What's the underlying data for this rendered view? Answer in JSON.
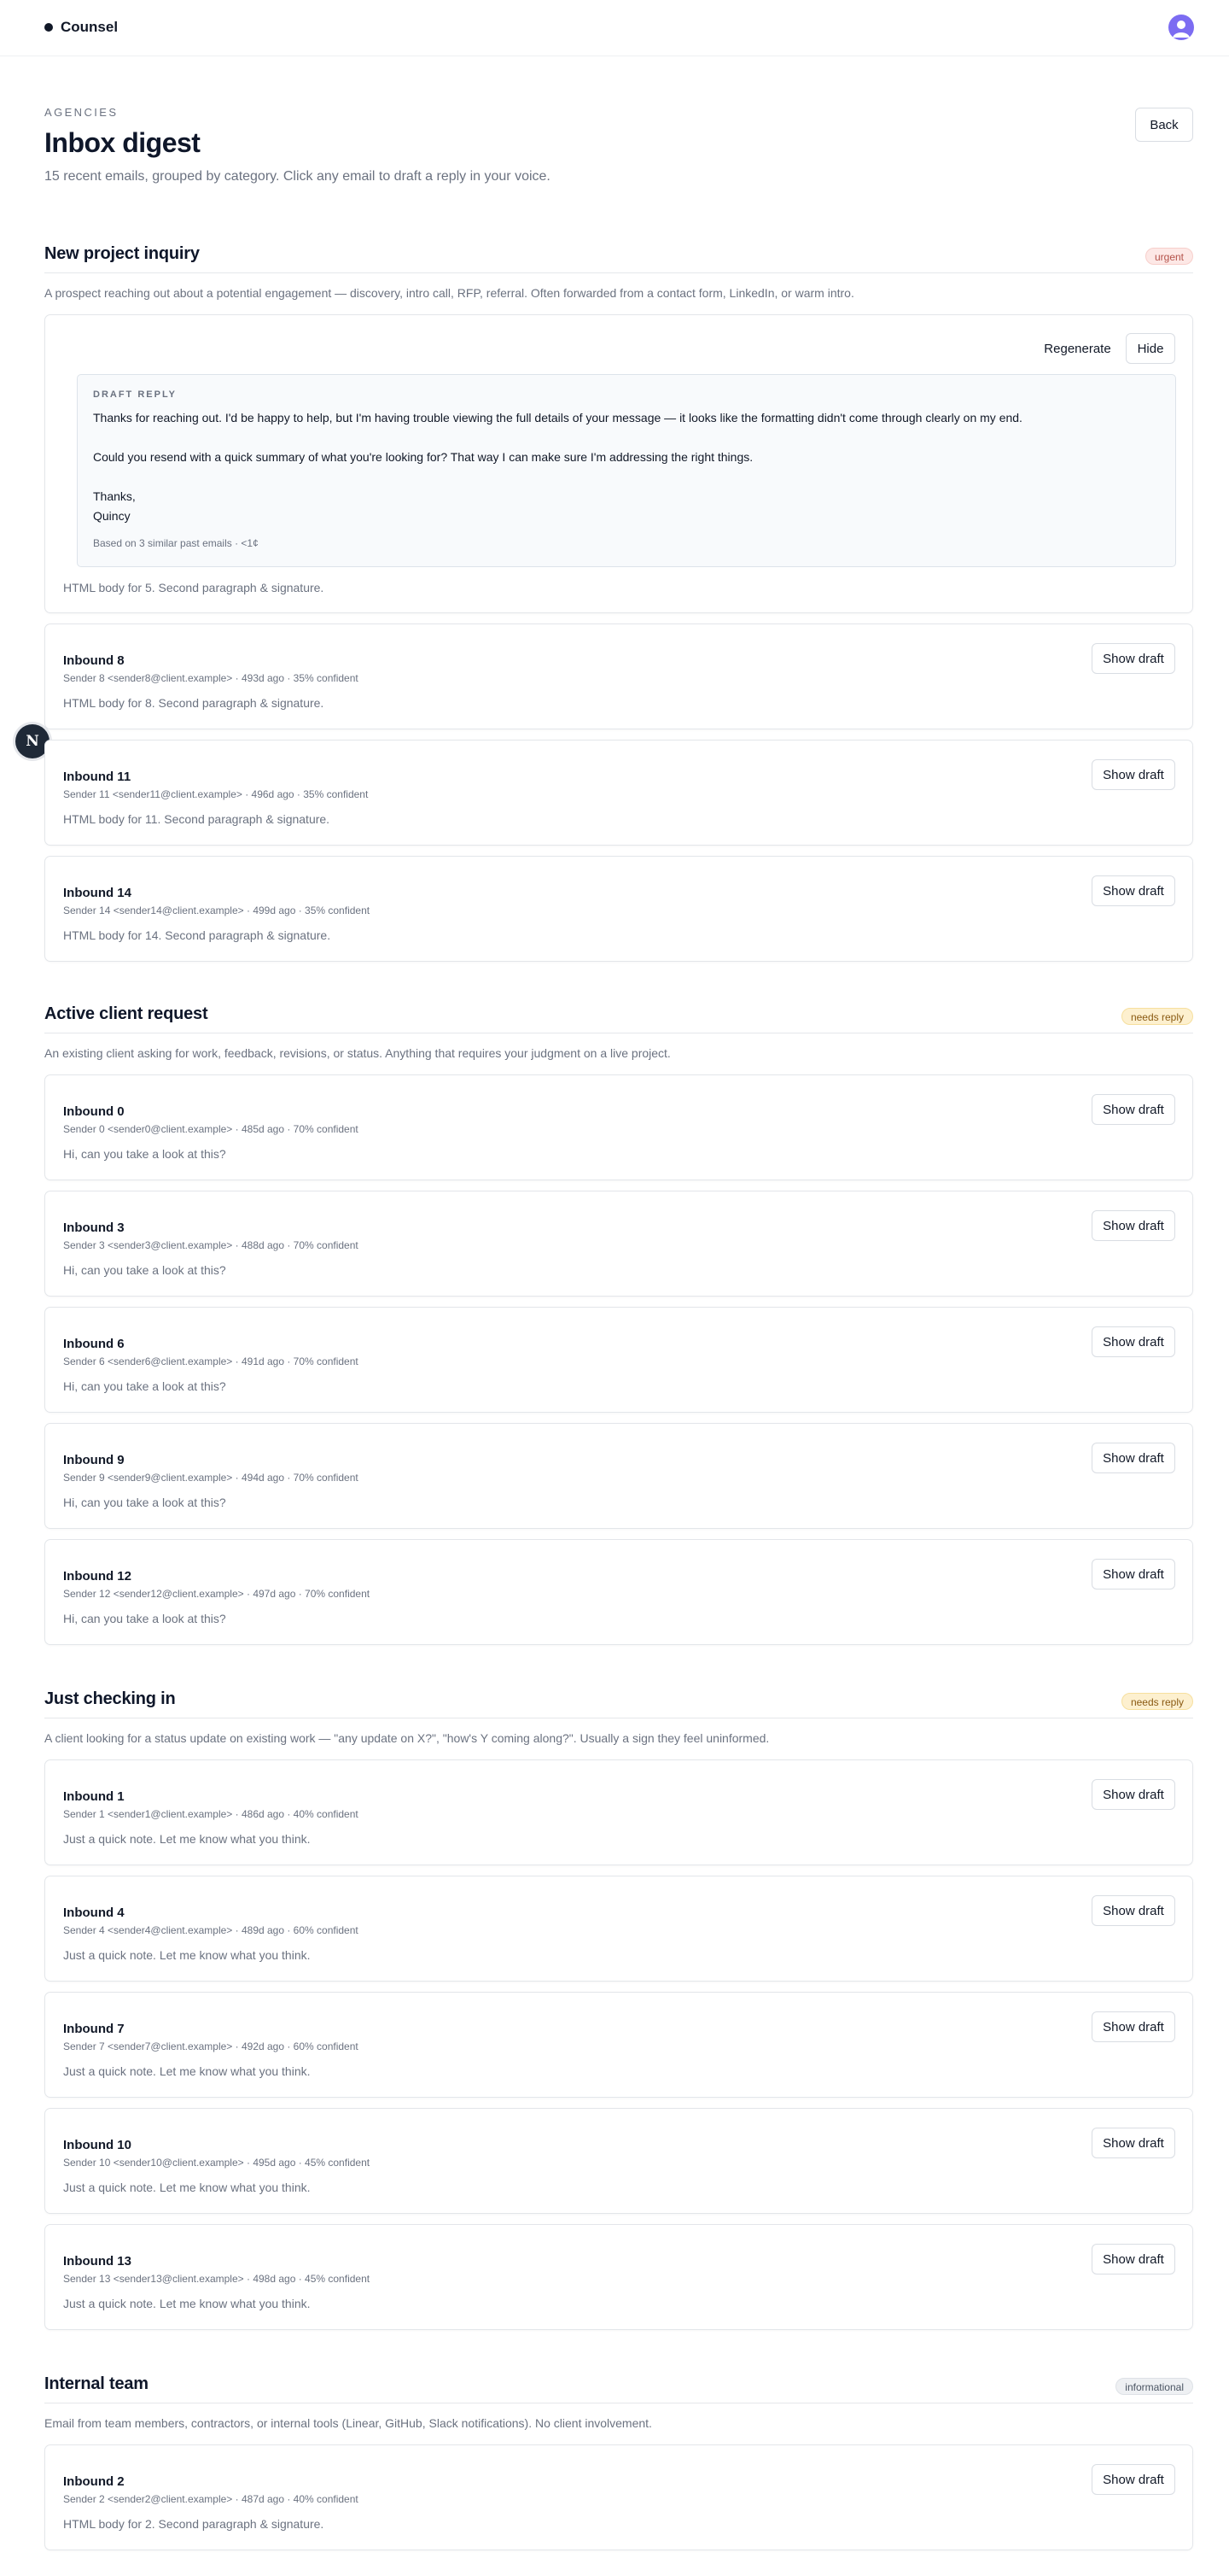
{
  "app": {
    "name": "Counsel"
  },
  "header": {
    "eyebrow": "AGENCIES",
    "title": "Inbox digest",
    "subtitle": "15 recent emails, grouped by category. Click any email to draft a reply in your voice.",
    "back_label": "Back"
  },
  "fab": {
    "label": "N"
  },
  "sections": [
    {
      "title": "New project inquiry",
      "badge": "urgent",
      "description": "A prospect reaching out about a potential engagement — discovery, intro call, RFP, referral. Often forwarded from a contact form, LinkedIn, or warm intro.",
      "open_card": {
        "regenerate_label": "Regenerate",
        "hide_label": "Hide",
        "draft_label": "DRAFT REPLY",
        "draft_lines": [
          "Thanks for reaching out. I'd be happy to help, but I'm having trouble viewing the full details of your message — it looks like the formatting didn't come through clearly on my end.",
          "Could you resend with a quick summary of what you're looking for? That way I can make sure I'm addressing the right things.",
          "Thanks,",
          "Quincy"
        ],
        "draft_footer": "Based on 3 similar past emails · <1¢",
        "body": "HTML body for 5. Second paragraph & signature."
      },
      "cards": [
        {
          "subject": "Inbound 8",
          "meta": "Sender 8 <sender8@client.example> · 493d ago · 35% confident",
          "body": "HTML body for 8. Second paragraph & signature.",
          "button": "Show draft"
        },
        {
          "subject": "Inbound 11",
          "meta": "Sender 11 <sender11@client.example> · 496d ago · 35% confident",
          "body": "HTML body for 11. Second paragraph & signature.",
          "button": "Show draft"
        },
        {
          "subject": "Inbound 14",
          "meta": "Sender 14 <sender14@client.example> · 499d ago · 35% confident",
          "body": "HTML body for 14. Second paragraph & signature.",
          "button": "Show draft"
        }
      ]
    },
    {
      "title": "Active client request",
      "badge": "needs reply",
      "description": "An existing client asking for work, feedback, revisions, or status. Anything that requires your judgment on a live project.",
      "cards": [
        {
          "subject": "Inbound 0",
          "meta": "Sender 0 <sender0@client.example> · 485d ago · 70% confident",
          "body": "Hi, can you take a look at this?",
          "button": "Show draft"
        },
        {
          "subject": "Inbound 3",
          "meta": "Sender 3 <sender3@client.example> · 488d ago · 70% confident",
          "body": "Hi, can you take a look at this?",
          "button": "Show draft"
        },
        {
          "subject": "Inbound 6",
          "meta": "Sender 6 <sender6@client.example> · 491d ago · 70% confident",
          "body": "Hi, can you take a look at this?",
          "button": "Show draft"
        },
        {
          "subject": "Inbound 9",
          "meta": "Sender 9 <sender9@client.example> · 494d ago · 70% confident",
          "body": "Hi, can you take a look at this?",
          "button": "Show draft"
        },
        {
          "subject": "Inbound 12",
          "meta": "Sender 12 <sender12@client.example> · 497d ago · 70% confident",
          "body": "Hi, can you take a look at this?",
          "button": "Show draft"
        }
      ]
    },
    {
      "title": "Just checking in",
      "badge": "needs reply",
      "description": "A client looking for a status update on existing work — \"any update on X?\", \"how's Y coming along?\". Usually a sign they feel uninformed.",
      "cards": [
        {
          "subject": "Inbound 1",
          "meta": "Sender 1 <sender1@client.example> · 486d ago · 40% confident",
          "body": "Just a quick note. Let me know what you think.",
          "button": "Show draft"
        },
        {
          "subject": "Inbound 4",
          "meta": "Sender 4 <sender4@client.example> · 489d ago · 60% confident",
          "body": "Just a quick note. Let me know what you think.",
          "button": "Show draft"
        },
        {
          "subject": "Inbound 7",
          "meta": "Sender 7 <sender7@client.example> · 492d ago · 60% confident",
          "body": "Just a quick note. Let me know what you think.",
          "button": "Show draft"
        },
        {
          "subject": "Inbound 10",
          "meta": "Sender 10 <sender10@client.example> · 495d ago · 45% confident",
          "body": "Just a quick note. Let me know what you think.",
          "button": "Show draft"
        },
        {
          "subject": "Inbound 13",
          "meta": "Sender 13 <sender13@client.example> · 498d ago · 45% confident",
          "body": "Just a quick note. Let me know what you think.",
          "button": "Show draft"
        }
      ]
    },
    {
      "title": "Internal team",
      "badge": "informational",
      "description": "Email from team members, contractors, or internal tools (Linear, GitHub, Slack notifications). No client involvement.",
      "cards": [
        {
          "subject": "Inbound 2",
          "meta": "Sender 2 <sender2@client.example> · 487d ago · 40% confident",
          "body": "HTML body for 2. Second paragraph & signature.",
          "button": "Show draft"
        }
      ]
    }
  ],
  "colors": {
    "urgent_bg": "#fde8e6",
    "needs_reply_bg": "#fdf0cf",
    "informational_bg": "#eef0f3",
    "avatar": "#7c6cf2"
  }
}
